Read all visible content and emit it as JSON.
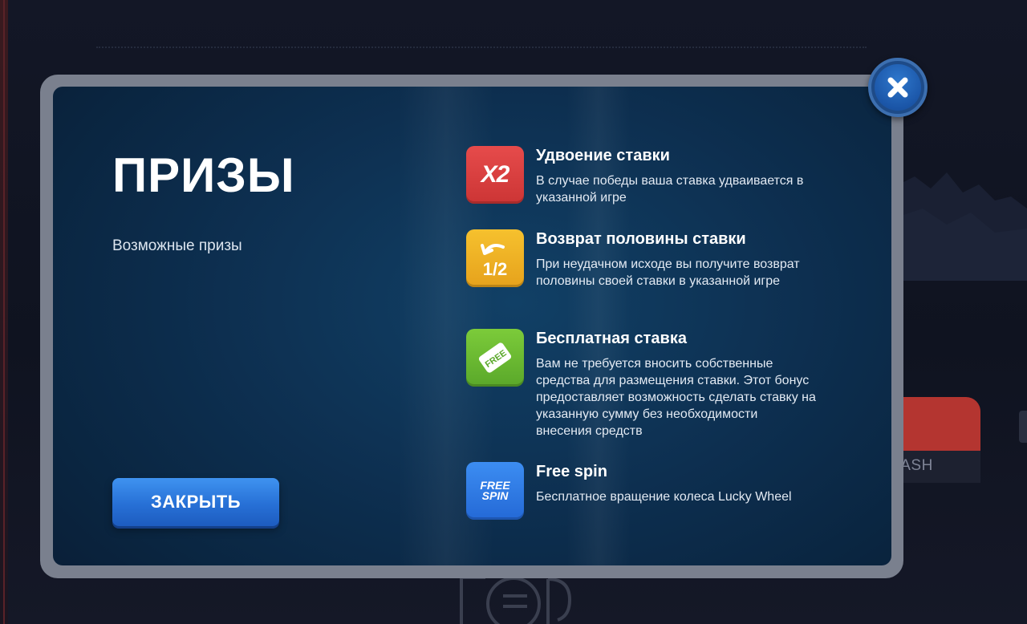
{
  "modal": {
    "title": "ПРИЗЫ",
    "subtitle": "Возможные призы",
    "close_button_label": "ЗАКРЫТЬ",
    "prizes": [
      {
        "icon": "x2-icon",
        "icon_text": "X2",
        "title": "Удвоение ставки",
        "description": "В случае победы ваша ставка удваивается в указанной игре"
      },
      {
        "icon": "half-refund-icon",
        "icon_text": "1/2",
        "title": "Возврат половины ставки",
        "description": "При неудачном исходе вы получите возврат половины своей ставки в указанной игре"
      },
      {
        "icon": "free-bet-icon",
        "icon_text": "FREE",
        "title": "Бесплатная ставка",
        "description": "Вам не требуется вносить собственные средства для размещения ставки. Этот бонус предоставляет возможность сделать ставку на указанную сумму без необходимости внесения средств"
      },
      {
        "icon": "free-spin-icon",
        "icon_text": "FREE SPIN",
        "title": "Free spin",
        "description": "Бесплатное вращение колеса Lucky Wheel"
      }
    ]
  },
  "background": {
    "crash_label": "RASH"
  },
  "colors": {
    "panel": "#0d2f50",
    "frame": "#7a808e",
    "button": "#2770d6",
    "x2": "#d93c3c",
    "half": "#eeb024",
    "free": "#6bbb32",
    "spin": "#2f7ae4"
  }
}
